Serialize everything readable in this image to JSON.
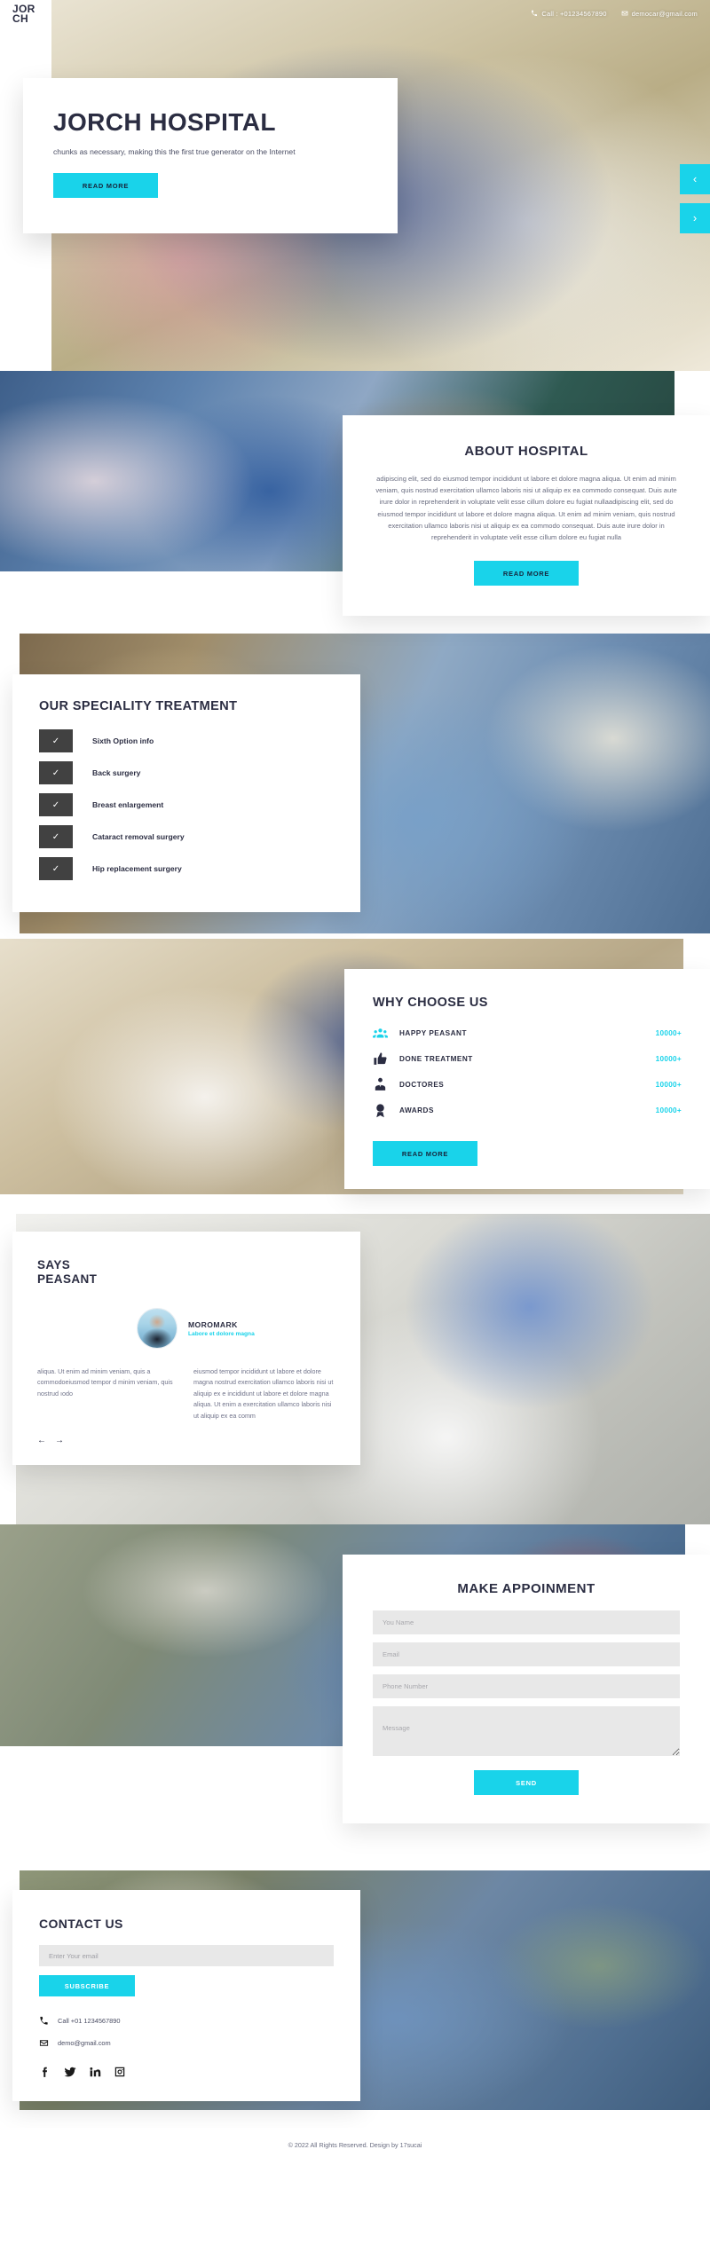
{
  "brand": {
    "line1": "JOR",
    "line2": "CH"
  },
  "topbar": {
    "phone_icon": "phone-icon",
    "phone": "Call : +01234567890",
    "email_icon": "mail-icon",
    "email": "democar@gmail.com"
  },
  "hero": {
    "title": "JORCH HOSPITAL",
    "subtitle": "chunks as necessary, making this the first true generator on the Internet",
    "button": "READ MORE",
    "prev_icon": "chevron-left-icon",
    "next_icon": "chevron-right-icon",
    "prev": "‹",
    "next": "›"
  },
  "about": {
    "title": "ABOUT HOSPITAL",
    "body": "adipiscing elit, sed do eiusmod tempor incididunt ut labore et dolore magna aliqua. Ut enim ad minim veniam, quis nostrud exercitation ullamco laboris nisi ut aliquip ex ea commodo consequat. Duis aute irure dolor in reprehenderit in voluptate velit esse cillum dolore eu fugiat nullaadipiscing elit, sed do eiusmod tempor incididunt ut labore et dolore magna aliqua. Ut enim ad minim veniam, quis nostrud exercitation ullamco laboris nisi ut aliquip ex ea commodo consequat. Duis aute irure dolor in reprehenderit in voluptate velit esse cillum dolore eu fugiat nulla",
    "button": "READ MORE"
  },
  "speciality": {
    "title": "OUR SPECIALITY TREATMENT",
    "check_icon": "check-icon",
    "check_glyph": "✓",
    "items": [
      {
        "label": "Sixth Option info"
      },
      {
        "label": "Back surgery"
      },
      {
        "label": "Breast enlargement"
      },
      {
        "label": "Cataract removal surgery"
      },
      {
        "label": "Hip replacement surgery"
      }
    ]
  },
  "why": {
    "title": "WHY CHOOSE US",
    "button": "READ MORE",
    "items": [
      {
        "icon": "people-group-icon",
        "label": "HAPPY PEASANT",
        "count": "10000+"
      },
      {
        "icon": "thumbs-up-icon",
        "label": "DONE TREATMENT",
        "count": "10000+"
      },
      {
        "icon": "doctor-icon",
        "label": "DOCTORES",
        "count": "10000+"
      },
      {
        "icon": "award-medal-icon",
        "label": "AWARDS",
        "count": "10000+"
      }
    ]
  },
  "testimonial": {
    "title_line1": "SAYS",
    "title_line2": "PEASANT",
    "avatar": "testimonial-avatar",
    "name": "MOROMARK",
    "role": "Labore et dolore magna",
    "text_left": "aliqua. Ut enim ad minim veniam, quis a commodoeiusmod tempor d minim veniam, quis nostrud ıodo",
    "text_right": "eiusmod tempor incididunt ut labore et dolore magna nostrud exercitation ullamco laboris nisi ut aliquip ex e incididunt ut labore et dolore magna aliqua. Ut enim a exercitation ullamco laboris nisi ut aliquip ex ea comm",
    "prev": "←",
    "next": "→"
  },
  "appointment": {
    "title": "MAKE APPOINMENT",
    "name_placeholder": "You Name",
    "email_placeholder": "Email",
    "phone_placeholder": "Phone Number",
    "message_placeholder": "Message",
    "button": "SEND"
  },
  "contact": {
    "title": "CONTACT US",
    "email_placeholder": "Enter Your email",
    "button": "SUBSCRIBE",
    "phone_icon": "phone-icon",
    "phone": "Call +01 1234567890",
    "mail_icon": "mail-icon",
    "email": "demo@gmail.com",
    "socials": [
      {
        "icon": "facebook-icon"
      },
      {
        "icon": "twitter-icon"
      },
      {
        "icon": "linkedin-icon"
      },
      {
        "icon": "instagram-icon"
      }
    ]
  },
  "footer": {
    "copyright": "© 2022 All Rights Reserved. Design by 17sucai"
  },
  "colors": {
    "accent": "#19d3ea",
    "dark": "#2b2d42",
    "check_box": "#414141",
    "field": "#e8e8e8"
  }
}
